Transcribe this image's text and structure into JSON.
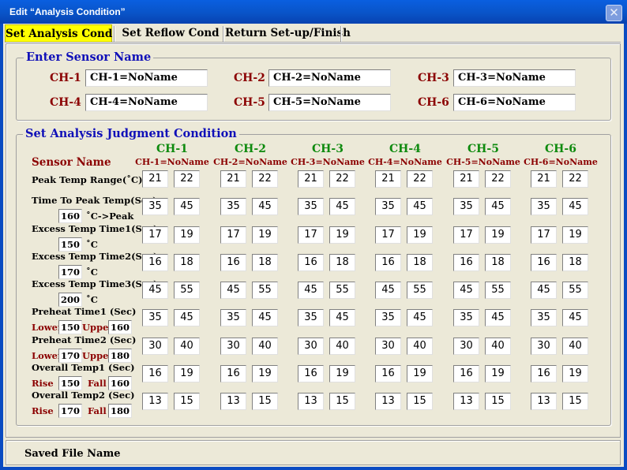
{
  "window": {
    "title": "Edit “Analysis Condition”",
    "close_glyph": "✕"
  },
  "tabs": [
    "Set Analysis Cond",
    "Set Reflow Cond",
    "Return Set-up/Finish"
  ],
  "sensor_group": {
    "title": "Enter Sensor Name",
    "channels": [
      {
        "label": "CH-1",
        "value": "CH-1=NoName"
      },
      {
        "label": "CH-2",
        "value": "CH-2=NoName"
      },
      {
        "label": "CH-3",
        "value": "CH-3=NoName"
      },
      {
        "label": "CH-4",
        "value": "CH-4=NoName"
      },
      {
        "label": "CH-5",
        "value": "CH-5=NoName"
      },
      {
        "label": "CH-6",
        "value": "CH-6=NoName"
      }
    ]
  },
  "judgment_group": {
    "title": "Set Analysis Judgment Condition",
    "sensor_name_label": "Sensor Name",
    "columns": [
      {
        "header": "CH-1",
        "subheader": "CH-1=NoName"
      },
      {
        "header": "CH-2",
        "subheader": "CH-2=NoName"
      },
      {
        "header": "CH-3",
        "subheader": "CH-3=NoName"
      },
      {
        "header": "CH-4",
        "subheader": "CH-4=NoName"
      },
      {
        "header": "CH-5",
        "subheader": "CH-5=NoName"
      },
      {
        "header": "CH-6",
        "subheader": "CH-6=NoName"
      }
    ],
    "rows": [
      {
        "label": "Peak Temp Range(˚C)",
        "values": [
          [
            "21",
            "22"
          ],
          [
            "21",
            "22"
          ],
          [
            "21",
            "22"
          ],
          [
            "21",
            "22"
          ],
          [
            "21",
            "22"
          ],
          [
            "21",
            "22"
          ]
        ]
      },
      {
        "label": "Time To Peak Temp(Sec)",
        "param": "160",
        "unit": "˚C->Peak",
        "values": [
          [
            "35",
            "45"
          ],
          [
            "35",
            "45"
          ],
          [
            "35",
            "45"
          ],
          [
            "35",
            "45"
          ],
          [
            "35",
            "45"
          ],
          [
            "35",
            "45"
          ]
        ]
      },
      {
        "label": "Excess Temp Time1(Sec)",
        "param": "150",
        "unit": "˚C",
        "values": [
          [
            "17",
            "19"
          ],
          [
            "17",
            "19"
          ],
          [
            "17",
            "19"
          ],
          [
            "17",
            "19"
          ],
          [
            "17",
            "19"
          ],
          [
            "17",
            "19"
          ]
        ]
      },
      {
        "label": "Excess Temp Time2(Sec)",
        "param": "170",
        "unit": "˚C",
        "values": [
          [
            "16",
            "18"
          ],
          [
            "16",
            "18"
          ],
          [
            "16",
            "18"
          ],
          [
            "16",
            "18"
          ],
          [
            "16",
            "18"
          ],
          [
            "16",
            "18"
          ]
        ]
      },
      {
        "label": "Excess Temp Time3(Sec)",
        "param": "200",
        "unit": "˚C",
        "values": [
          [
            "45",
            "55"
          ],
          [
            "45",
            "55"
          ],
          [
            "45",
            "55"
          ],
          [
            "45",
            "55"
          ],
          [
            "45",
            "55"
          ],
          [
            "45",
            "55"
          ]
        ]
      },
      {
        "label": "Preheat Time1 (Sec)",
        "sub1_label": "Lower",
        "sub1_value": "150",
        "sub2_label": "Upper",
        "sub2_value": "160",
        "values": [
          [
            "35",
            "45"
          ],
          [
            "35",
            "45"
          ],
          [
            "35",
            "45"
          ],
          [
            "35",
            "45"
          ],
          [
            "35",
            "45"
          ],
          [
            "35",
            "45"
          ]
        ]
      },
      {
        "label": "Preheat Time2 (Sec)",
        "sub1_label": "Lower",
        "sub1_value": "170",
        "sub2_label": "Upper",
        "sub2_value": "180",
        "values": [
          [
            "30",
            "40"
          ],
          [
            "30",
            "40"
          ],
          [
            "30",
            "40"
          ],
          [
            "30",
            "40"
          ],
          [
            "30",
            "40"
          ],
          [
            "30",
            "40"
          ]
        ]
      },
      {
        "label": "Overall Temp1 (Sec)",
        "sub1_label": "Rise",
        "sub1_value": "150",
        "sub2_label": "Fall",
        "sub2_value": "160",
        "values": [
          [
            "16",
            "19"
          ],
          [
            "16",
            "19"
          ],
          [
            "16",
            "19"
          ],
          [
            "16",
            "19"
          ],
          [
            "16",
            "19"
          ],
          [
            "16",
            "19"
          ]
        ]
      },
      {
        "label": "Overall Temp2 (Sec)",
        "sub1_label": "Rise",
        "sub1_value": "170",
        "sub2_label": "Fall",
        "sub2_value": "180",
        "values": [
          [
            "13",
            "15"
          ],
          [
            "13",
            "15"
          ],
          [
            "13",
            "15"
          ],
          [
            "13",
            "15"
          ],
          [
            "13",
            "15"
          ],
          [
            "13",
            "15"
          ]
        ]
      }
    ]
  },
  "status": {
    "saved_file_label": "Saved File Name"
  }
}
